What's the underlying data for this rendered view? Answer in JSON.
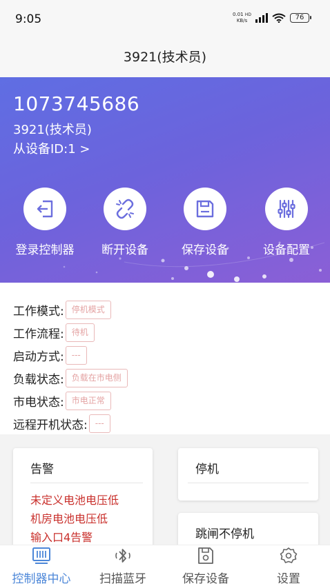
{
  "status_bar": {
    "time": "9:05",
    "net_speed_line1": "0.01",
    "net_speed_line2": "KB/s",
    "hd": "HD",
    "battery": "76"
  },
  "titlebar": {
    "title": "3921(技术员)"
  },
  "device": {
    "number": "1073745686",
    "user": "3921(技术员)",
    "slave": "从设备ID:1 >"
  },
  "actions": [
    {
      "label": "登录控制器",
      "icon": "login-icon"
    },
    {
      "label": "断开设备",
      "icon": "unlink-icon"
    },
    {
      "label": "保存设备",
      "icon": "save-icon"
    },
    {
      "label": "设备配置",
      "icon": "sliders-icon"
    }
  ],
  "status": {
    "work_mode": {
      "label": "工作模式:",
      "value": "停机模式"
    },
    "work_flow": {
      "label": "工作流程:",
      "value": "待机"
    },
    "start_method": {
      "label": "启动方式:",
      "value": "---"
    },
    "load_state": {
      "label": "负载状态:",
      "value": "负载在市电侧"
    },
    "mains_state": {
      "label": "市电状态:",
      "value": "市电正常"
    },
    "remote_start": {
      "label": "远程开机状态:",
      "value": "---"
    }
  },
  "cards": {
    "alarm": {
      "title": "告警",
      "items": [
        "未定义电池电压低",
        "机房电池电压低",
        "输入口4告警"
      ]
    },
    "stop": {
      "title": "停机"
    },
    "trip": {
      "title": "跳闸不停机"
    }
  },
  "nav": [
    {
      "label": "控制器中心",
      "icon": "controller-icon",
      "active": true
    },
    {
      "label": "扫描蓝牙",
      "icon": "bluetooth-icon",
      "active": false
    },
    {
      "label": "保存设备",
      "icon": "save-device-icon",
      "active": false
    },
    {
      "label": "设置",
      "icon": "gear-icon",
      "active": false
    }
  ],
  "colors": {
    "accent": "#4b86d8",
    "hero_start": "#5f6ee3",
    "hero_end": "#8b5fd6",
    "alarm_text": "#c9302c",
    "status_value_text": "#e4a3a3"
  }
}
